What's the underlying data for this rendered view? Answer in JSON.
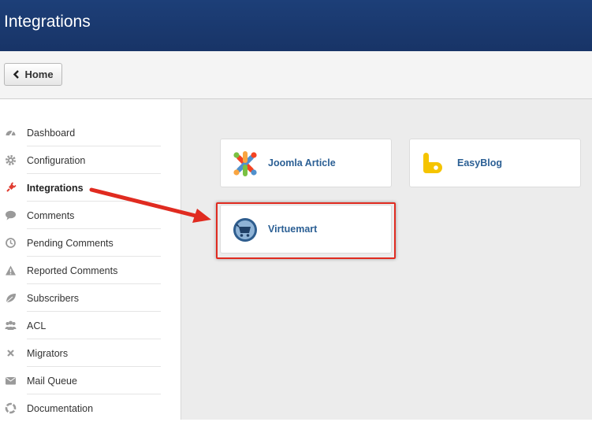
{
  "header": {
    "title": "Integrations"
  },
  "toolbar": {
    "home_label": "Home"
  },
  "sidebar": {
    "items": [
      {
        "label": "Dashboard",
        "icon": "dashboard-icon",
        "active": false
      },
      {
        "label": "Configuration",
        "icon": "gear-icon",
        "active": false
      },
      {
        "label": "Integrations",
        "icon": "plug-icon",
        "active": true
      },
      {
        "label": "Comments",
        "icon": "comment-icon",
        "active": false
      },
      {
        "label": "Pending Comments",
        "icon": "clock-icon",
        "active": false
      },
      {
        "label": "Reported Comments",
        "icon": "warning-icon",
        "active": false
      },
      {
        "label": "Subscribers",
        "icon": "leaf-icon",
        "active": false
      },
      {
        "label": "ACL",
        "icon": "users-icon",
        "active": false
      },
      {
        "label": "Migrators",
        "icon": "cross-icon",
        "active": false
      },
      {
        "label": "Mail Queue",
        "icon": "envelope-icon",
        "active": false
      },
      {
        "label": "Documentation",
        "icon": "lifebuoy-icon",
        "active": false
      }
    ]
  },
  "integrations": [
    {
      "label": "Joomla Article",
      "icon": "joomla-logo-icon"
    },
    {
      "label": "EasyBlog",
      "icon": "easyblog-logo-icon"
    },
    {
      "label": "Virtuemart",
      "icon": "virtuemart-logo-icon"
    }
  ],
  "colors": {
    "header": "#1d3f78",
    "link": "#2b5f94",
    "annotation": "#e02b20",
    "active_icon": "#e03c31"
  }
}
